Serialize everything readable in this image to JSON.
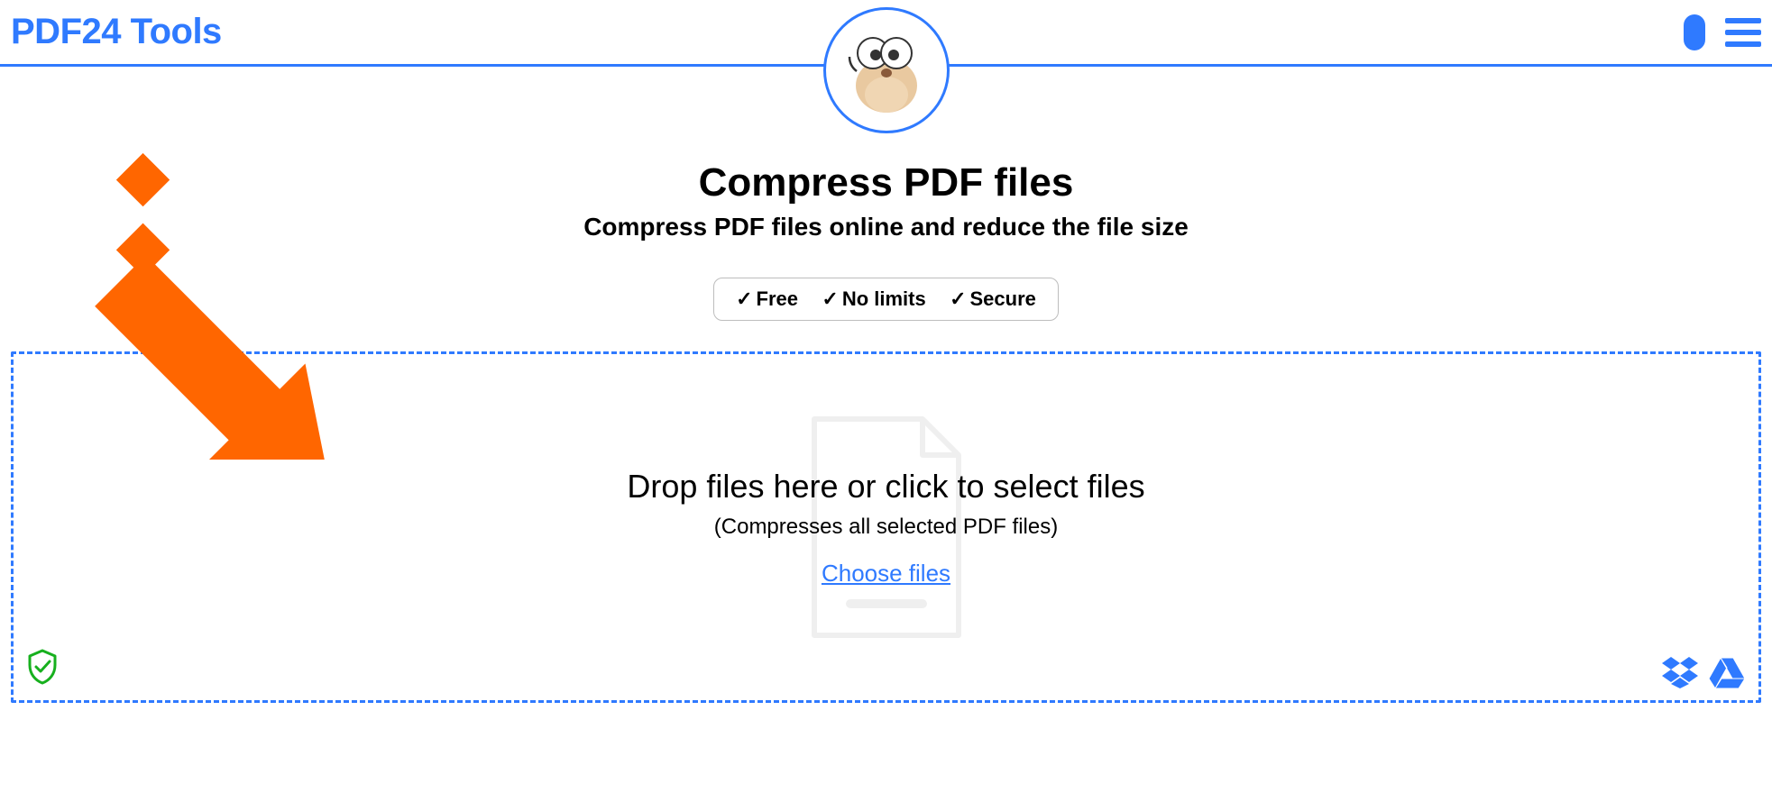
{
  "header": {
    "brand": "PDF24 Tools"
  },
  "main": {
    "title": "Compress PDF files",
    "subtitle": "Compress PDF files online and reduce the file size",
    "badges": {
      "item1": "Free",
      "item2": "No limits",
      "item3": "Secure"
    }
  },
  "dropzone": {
    "title": "Drop files here or click to select files",
    "subtitle": "(Compresses all selected PDF files)",
    "choose": "Choose files"
  },
  "icons": {
    "shield": "shield-check-icon",
    "dropbox": "dropbox-icon",
    "gdrive": "google-drive-icon"
  },
  "colors": {
    "primary": "#2f7aff",
    "accent": "#ff6600"
  }
}
